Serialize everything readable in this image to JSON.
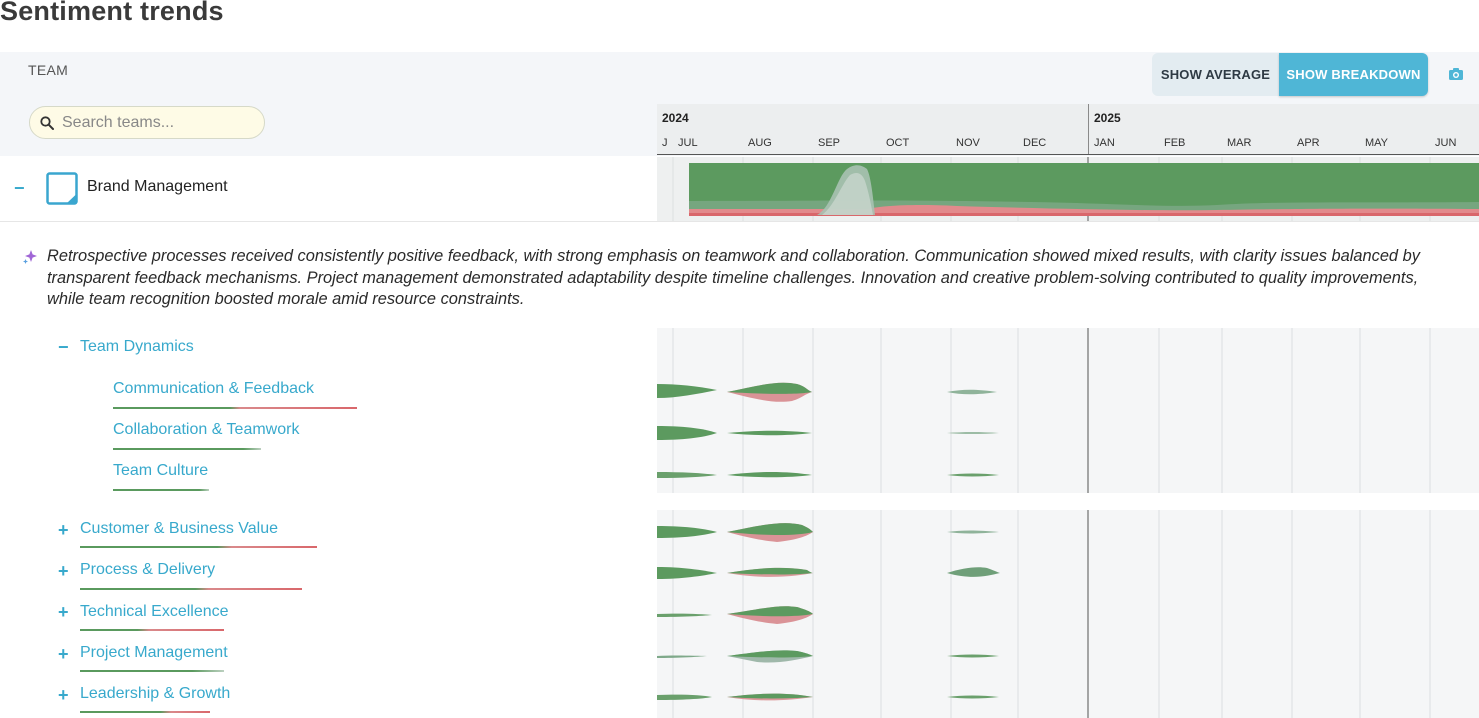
{
  "page": {
    "title": "Sentiment trends"
  },
  "header": {
    "team_label": "TEAM",
    "search_placeholder": "Search teams...",
    "show_average": "SHOW AVERAGE",
    "show_breakdown": "SHOW BREAKDOWN"
  },
  "timeline": {
    "years": [
      "2024",
      "2025"
    ],
    "months": [
      "J",
      "JUL",
      "AUG",
      "SEP",
      "OCT",
      "NOV",
      "DEC",
      "JAN",
      "FEB",
      "MAR",
      "APR",
      "MAY",
      "JUN"
    ]
  },
  "team": {
    "name": "Brand Management",
    "collapse_symbol": "−",
    "summary": "Retrospective processes received consistently positive feedback, with strong emphasis on teamwork and collaboration. Communication showed mixed results, with clarity issues balanced by transparent feedback mechanisms. Project management demonstrated adaptability despite timeline challenges. Innovation and creative problem-solving contributed to quality improvements, while team recognition boosted morale amid resource constraints."
  },
  "categories": {
    "team_dynamics": {
      "label": "Team Dynamics",
      "symbol": "−",
      "children": [
        {
          "label": "Communication & Feedback"
        },
        {
          "label": "Collaboration & Teamwork"
        },
        {
          "label": "Team Culture"
        }
      ]
    },
    "others": [
      {
        "label": "Customer & Business Value",
        "symbol": "+"
      },
      {
        "label": "Process & Delivery",
        "symbol": "+"
      },
      {
        "label": "Technical Excellence",
        "symbol": "+"
      },
      {
        "label": "Project Management",
        "symbol": "+"
      },
      {
        "label": "Leadership & Growth",
        "symbol": "+"
      }
    ]
  },
  "colors": {
    "accent": "#4fb6d6",
    "label": "#38a9cc",
    "positive": "#5a9a5e",
    "negative": "#d9676b",
    "neutral": "#9fb8aa"
  }
}
